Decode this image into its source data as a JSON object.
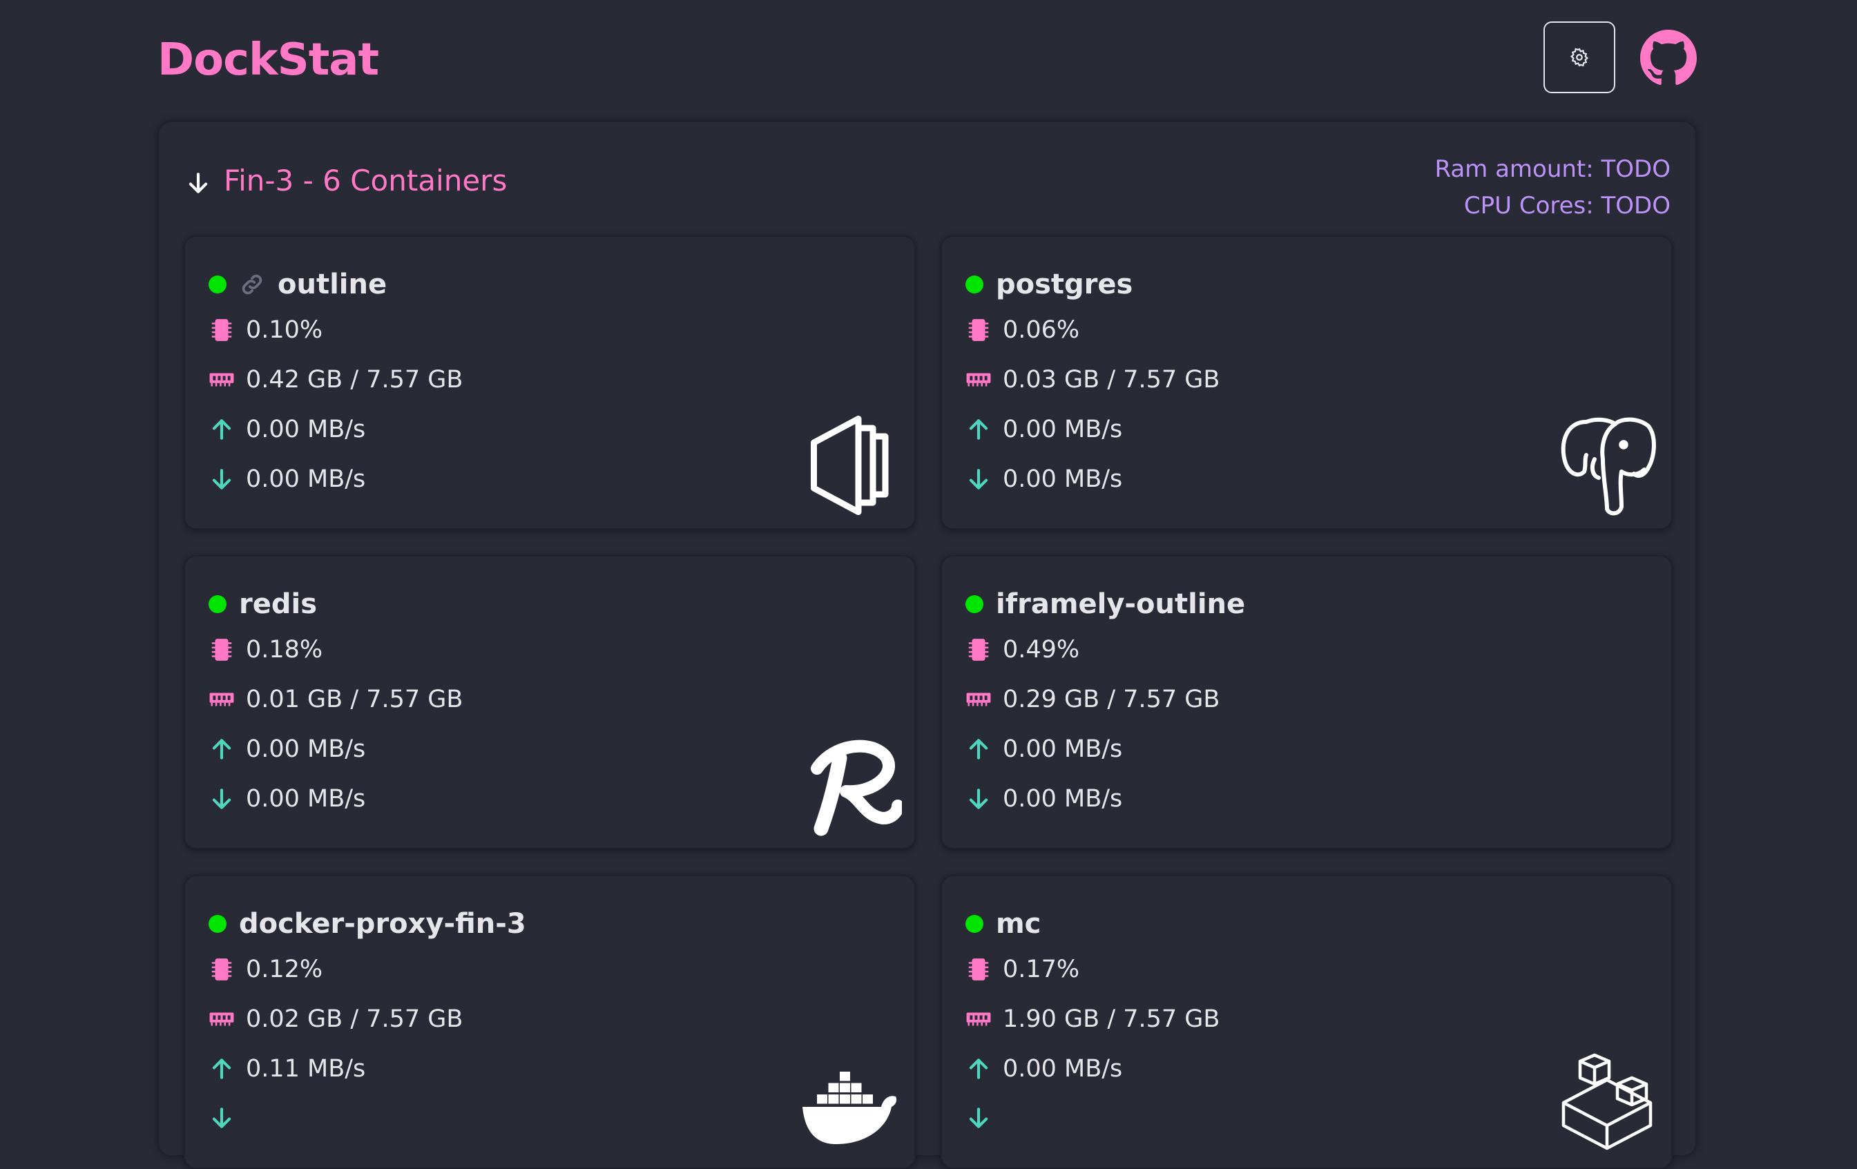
{
  "app": {
    "title": "DockStat"
  },
  "host": {
    "title": "Fin-3 - 6 Containers",
    "ram_label": "Ram amount: TODO",
    "cpu_label": "CPU Cores: TODO"
  },
  "containers": [
    {
      "name": "outline",
      "status": "running",
      "has_link": true,
      "cpu": "0.10%",
      "ram": "0.42 GB / 7.57 GB",
      "net_up": "0.00 MB/s",
      "net_down": "0.00 MB/s",
      "icon": "outline-logo-icon"
    },
    {
      "name": "postgres",
      "status": "running",
      "has_link": false,
      "cpu": "0.06%",
      "ram": "0.03 GB / 7.57 GB",
      "net_up": "0.00 MB/s",
      "net_down": "0.00 MB/s",
      "icon": "postgres-elephant-icon"
    },
    {
      "name": "redis",
      "status": "running",
      "has_link": false,
      "cpu": "0.18%",
      "ram": "0.01 GB / 7.57 GB",
      "net_up": "0.00 MB/s",
      "net_down": "0.00 MB/s",
      "icon": "redis-logo-icon"
    },
    {
      "name": "iframely-outline",
      "status": "running",
      "has_link": false,
      "cpu": "0.49%",
      "ram": "0.29 GB / 7.57 GB",
      "net_up": "0.00 MB/s",
      "net_down": "0.00 MB/s",
      "icon": "none"
    },
    {
      "name": "docker-proxy-fin-3",
      "status": "running",
      "has_link": false,
      "cpu": "0.12%",
      "ram": "0.02 GB / 7.57 GB",
      "net_up": "0.11 MB/s",
      "net_down": "",
      "icon": "docker-whale-icon"
    },
    {
      "name": "mc",
      "status": "running",
      "has_link": false,
      "cpu": "0.17%",
      "ram": "1.90 GB / 7.57 GB",
      "net_up": "0.00 MB/s",
      "net_down": "",
      "icon": "minecraft-blocks-icon"
    }
  ],
  "colors": {
    "background": "#282a36",
    "accent": "#ff79c6",
    "meta_text": "#bd93f9",
    "status_running": "#00e500",
    "network_arrow": "#4fd6be"
  }
}
